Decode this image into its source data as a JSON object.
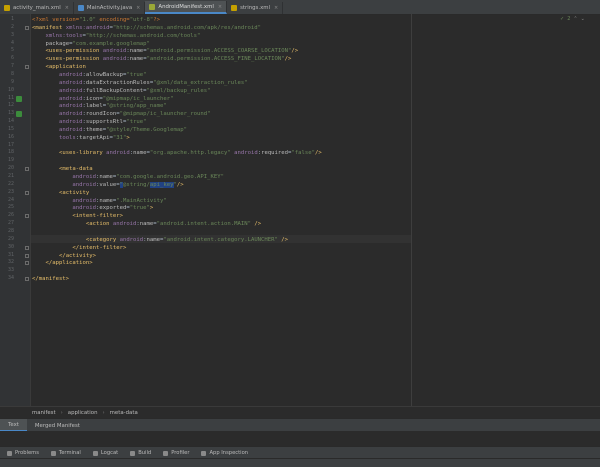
{
  "tabs": [
    {
      "label": "activity_main.xml",
      "icon": "xml-file-icon",
      "color": "#c4a000",
      "active": false
    },
    {
      "label": "MainActivity.java",
      "icon": "java-class-icon",
      "color": "#4a88c7",
      "active": false
    },
    {
      "label": "AndroidManifest.xml",
      "icon": "manifest-file-icon",
      "color": "#9aa837",
      "active": true
    },
    {
      "label": "strings.xml",
      "icon": "xml-file-icon",
      "color": "#c4a000",
      "active": false
    }
  ],
  "inspection": {
    "count": "2"
  },
  "code_lines": [
    {
      "n": "1",
      "html": "<span class='pi'>&lt;?xml version=</span><span class='vl'>\"1.0\"</span><span class='pi'> encoding=</span><span class='vl'>\"utf-8\"</span><span class='pi'>?&gt;</span>"
    },
    {
      "n": "2",
      "html": "<span class='tg'>&lt;manifest</span> <span class='ns'>xmlns:android</span>=<span class='vl'>\"http://schemas.android.com/apk/res/android\"</span>"
    },
    {
      "n": "3",
      "html": "    <span class='ns'>xmlns:tools</span>=<span class='vl'>\"http://schemas.android.com/tools\"</span>"
    },
    {
      "n": "4",
      "html": "    <span class='at'>package</span>=<span class='vl'>\"com.example.googlemap\"</span>"
    },
    {
      "n": "5",
      "html": "    <span class='tg'>&lt;uses-permission</span> <span class='ns'>android</span>:<span class='at'>name</span>=<span class='vl'>\"android.permission.ACCESS_COARSE_LOCATION\"</span><span class='tg'>/&gt;</span>"
    },
    {
      "n": "6",
      "html": "    <span class='tg'>&lt;uses-permission</span> <span class='ns'>android</span>:<span class='at'>name</span>=<span class='vl'>\"android.permission.ACCESS_FINE_LOCATION\"</span><span class='tg'>/&gt;</span>"
    },
    {
      "n": "7",
      "html": "    <span class='tg'>&lt;application</span>"
    },
    {
      "n": "8",
      "html": "        <span class='ns'>android</span>:<span class='at'>allowBackup</span>=<span class='vl'>\"true\"</span>"
    },
    {
      "n": "9",
      "html": "        <span class='ns'>android</span>:<span class='at'>dataExtractionRules</span>=<span class='vl'>\"@xml/data_extraction_rules\"</span>"
    },
    {
      "n": "10",
      "html": "        <span class='ns'>android</span>:<span class='at'>fullBackupContent</span>=<span class='vl'>\"@xml/backup_rules\"</span>"
    },
    {
      "n": "11",
      "html": "        <span class='ns'>android</span>:<span class='at'>icon</span>=<span class='vl'>\"@mipmap/ic_launcher\"</span>"
    },
    {
      "n": "12",
      "html": "        <span class='ns'>android</span>:<span class='at'>label</span>=<span class='vl'>\"@string/app_name\"</span>"
    },
    {
      "n": "13",
      "html": "        <span class='ns'>android</span>:<span class='at'>roundIcon</span>=<span class='vl'>\"@mipmap/ic_launcher_round\"</span>"
    },
    {
      "n": "14",
      "html": "        <span class='ns'>android</span>:<span class='at'>supportsRtl</span>=<span class='vl'>\"true\"</span>"
    },
    {
      "n": "15",
      "html": "        <span class='ns'>android</span>:<span class='at'>theme</span>=<span class='vl'>\"@style/Theme.Googlemap\"</span>"
    },
    {
      "n": "16",
      "html": "        <span class='ns'>tools</span>:<span class='at'>targetApi</span>=<span class='vl'>\"31\"</span><span class='tg'>&gt;</span>"
    },
    {
      "n": "17",
      "html": ""
    },
    {
      "n": "18",
      "html": "        <span class='tg'>&lt;uses-library</span> <span class='ns'>android</span>:<span class='at'>name</span>=<span class='vl'>\"org.apache.http.legacy\"</span> <span class='ns'>android</span>:<span class='at'>required</span>=<span class='vl'>\"false\"</span><span class='tg'>/&gt;</span>"
    },
    {
      "n": "19",
      "html": ""
    },
    {
      "n": "20",
      "html": "        <span class='tg'>&lt;meta-data</span>"
    },
    {
      "n": "21",
      "html": "            <span class='ns'>android</span>:<span class='at'>name</span>=<span class='vl'>\"com.google.android.geo.API_KEY\"</span>"
    },
    {
      "n": "22",
      "html": "            <span class='ns'>android</span>:<span class='at'>value</span>=<span class='vl'><span class='sel'>\"</span>@string/<span class='sel'>api_key</span>\"</span><span class='tg'>/&gt;</span>"
    },
    {
      "n": "23",
      "html": "        <span class='tg'>&lt;activity</span>"
    },
    {
      "n": "24",
      "html": "            <span class='ns'>android</span>:<span class='at'>name</span>=<span class='vl'>\".MainActivity\"</span>"
    },
    {
      "n": "25",
      "html": "            <span class='ns'>android</span>:<span class='at'>exported</span>=<span class='vl'>\"true\"</span><span class='tg'>&gt;</span>"
    },
    {
      "n": "26",
      "html": "            <span class='tg'>&lt;intent-filter&gt;</span>"
    },
    {
      "n": "27",
      "html": "                <span class='tg'>&lt;action</span> <span class='ns'>android</span>:<span class='at'>name</span>=<span class='vl'>\"android.intent.action.MAIN\"</span> <span class='tg'>/&gt;</span>"
    },
    {
      "n": "28",
      "html": ""
    },
    {
      "n": "29",
      "html": "                <span class='tg'>&lt;category</span> <span class='ns'>android</span>:<span class='at'>name</span>=<span class='vl'>\"android.intent.category.LAUNCHER\"</span> <span class='tg'>/&gt;</span>"
    },
    {
      "n": "30",
      "html": "            <span class='tg'>&lt;/intent-filter&gt;</span>"
    },
    {
      "n": "31",
      "html": "        <span class='tg'>&lt;/activity&gt;</span>"
    },
    {
      "n": "32",
      "html": "    <span class='tg'>&lt;/application&gt;</span>"
    },
    {
      "n": "33",
      "html": ""
    },
    {
      "n": "34",
      "html": "<span class='tg'>&lt;/manifest&gt;</span>"
    }
  ],
  "breadcrumb": [
    "manifest",
    "application",
    "meta-data"
  ],
  "view_tabs": [
    {
      "label": "Text",
      "active": true
    },
    {
      "label": "Merged Manifest",
      "active": false
    }
  ],
  "tool_windows": [
    {
      "label": "Problems",
      "icon": "problems-icon"
    },
    {
      "label": "Terminal",
      "icon": "terminal-icon"
    },
    {
      "label": "Logcat",
      "icon": "logcat-icon"
    },
    {
      "label": "Build",
      "icon": "build-icon"
    },
    {
      "label": "Profiler",
      "icon": "profiler-icon"
    },
    {
      "label": "App Inspection",
      "icon": "app-inspection-icon"
    }
  ]
}
